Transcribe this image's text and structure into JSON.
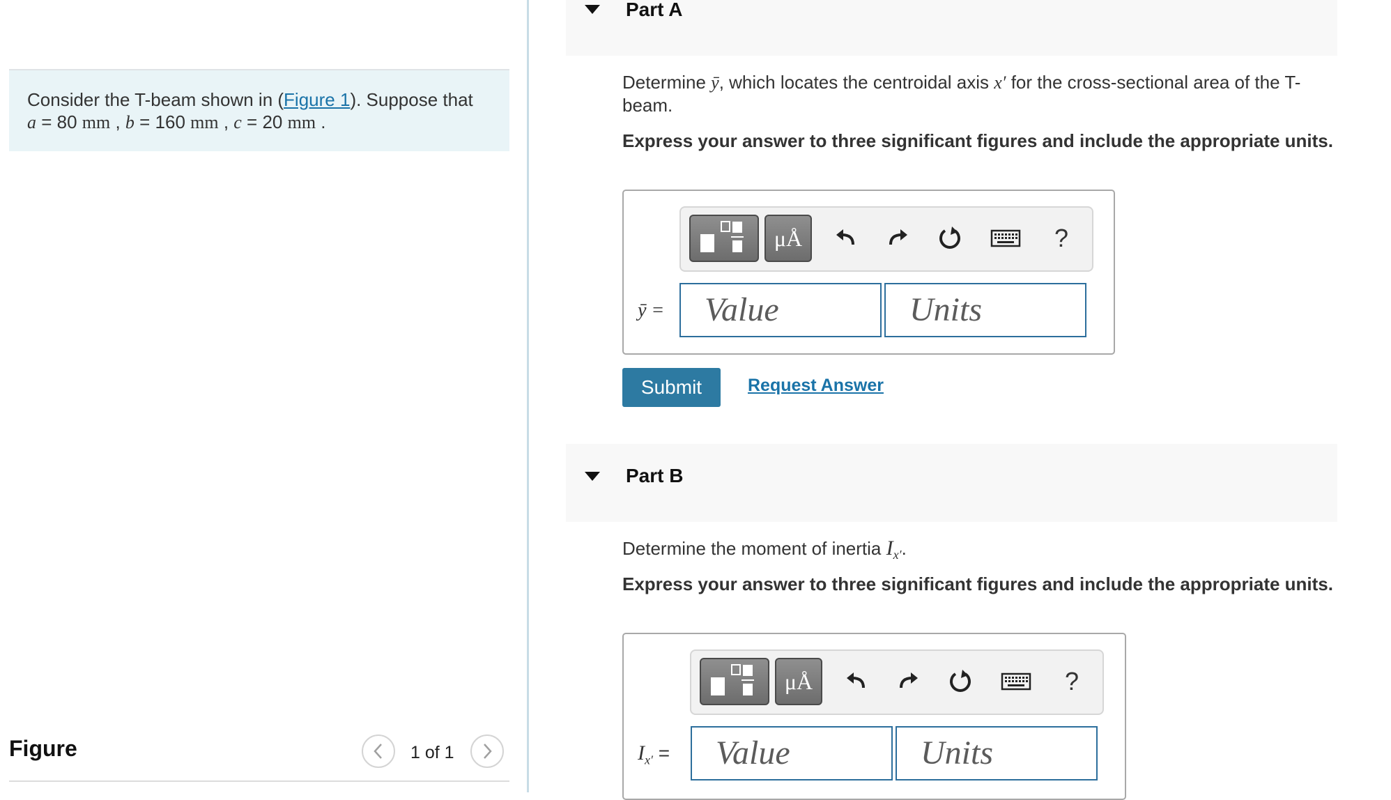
{
  "problem": {
    "intro_before_link": "Consider the T-beam shown in (",
    "figure_link": "Figure 1",
    "intro_after_link": "). Suppose that",
    "a_var": "a",
    "a_value": " = 80 ",
    "a_unit": "mm",
    "sep1": " , ",
    "b_var": "b",
    "b_value": " = 160 ",
    "b_unit": "mm",
    "sep2": " , ",
    "c_var": "c",
    "c_value": " = 20 ",
    "c_unit": "mm",
    "end": " ."
  },
  "figure_panel": {
    "label": "Figure",
    "page": "1 of 1",
    "prev_icon": "chevron-left-icon",
    "next_icon": "chevron-right-icon"
  },
  "part_a": {
    "title": "Part A",
    "question_1": "Determine ",
    "question_ybar": "ȳ",
    "question_2": ", which locates the centroidal axis ",
    "question_x": "x′",
    "question_3": " for the cross-sectional area of the T-beam.",
    "instruction": "Express your answer to three significant figures and include the appropriate units.",
    "input_label": "ȳ =",
    "value_placeholder": "Value",
    "units_placeholder": "Units",
    "submit_label": "Submit",
    "request_label": "Request Answer"
  },
  "part_b": {
    "title": "Part B",
    "question_1": "Determine the moment of inertia ",
    "question_I": "I",
    "question_sub": "x′",
    "question_end": ".",
    "instruction": "Express your answer to three significant figures and include the appropriate units.",
    "input_label_I": "I",
    "input_label_sub": "x′",
    "input_label_eq": " =",
    "value_placeholder": "Value",
    "units_placeholder": "Units"
  },
  "toolbar": {
    "template_icon": "fraction-template-icon",
    "units_button": "μÅ",
    "undo_icon": "undo-icon",
    "redo_icon": "redo-icon",
    "reset_icon": "reset-icon",
    "keyboard_icon": "keyboard-icon",
    "help_label": "?"
  },
  "colors": {
    "accent": "#2d7aa2",
    "link": "#1a73a8",
    "problem_bg": "#e9f4f7",
    "header_bg": "#f8f8f8",
    "input_border": "#2c6e9c"
  }
}
